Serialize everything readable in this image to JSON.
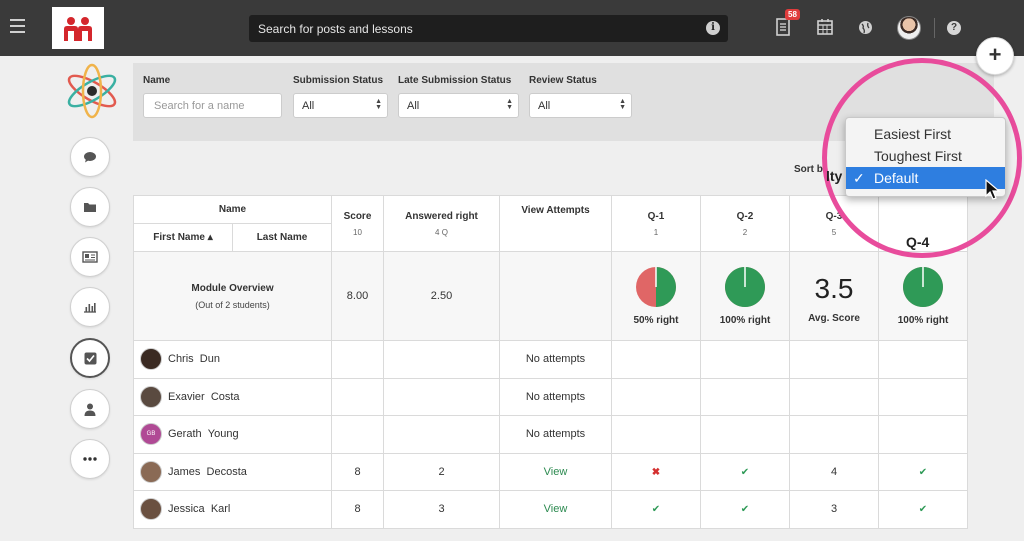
{
  "header": {
    "search_placeholder": "Search for posts and lessons",
    "notifications_count": "58"
  },
  "filters": {
    "name_label": "Name",
    "name_placeholder": "Search for a name",
    "submission_label": "Submission Status",
    "submission_value": "All",
    "late_label": "Late Submission Status",
    "late_value": "All",
    "review_label": "Review Status",
    "review_value": "All"
  },
  "sort": {
    "label": "Sort b",
    "peek_text": "lty",
    "options": [
      "Easiest First",
      "Toughest First",
      "Default"
    ],
    "selected_index": 2,
    "check": "✓"
  },
  "table": {
    "name_header": "Name",
    "first_name_header": "First Name ▴",
    "last_name_header": "Last Name",
    "score_header": "Score",
    "score_sub": "10",
    "answered_header": "Answered right",
    "answered_sub": "4 Q",
    "attempts_header": "View Attempts",
    "questions": [
      {
        "label": "Q-1",
        "sub": "1"
      },
      {
        "label": "Q-2",
        "sub": "2"
      },
      {
        "label": "Q-3",
        "sub": "5"
      },
      {
        "label": "Q-4",
        "sub": ""
      }
    ],
    "overview": {
      "title": "Module Overview",
      "subtitle": "(Out of 2 students)",
      "score": "8.00",
      "answered": "2.50",
      "q1_label": "50% right",
      "q1_fraction": 0.5,
      "q2_label": "100% right",
      "q2_fraction": 1.0,
      "q3_value": "3.5",
      "q3_label": "Avg. Score",
      "q4_label": "100% right",
      "q4_fraction": 1.0
    },
    "students": [
      {
        "first": "Chris",
        "last": "Dun",
        "score": "",
        "answered": "",
        "attempts": "No attempts",
        "q1": "",
        "q2": "",
        "q3": "",
        "q4": ""
      },
      {
        "first": "Exavier",
        "last": "Costa",
        "score": "",
        "answered": "",
        "attempts": "No attempts",
        "q1": "",
        "q2": "",
        "q3": "",
        "q4": ""
      },
      {
        "first": "Gerath",
        "last": "Young",
        "initials": "GB",
        "score": "",
        "answered": "",
        "attempts": "No attempts",
        "q1": "",
        "q2": "",
        "q3": "",
        "q4": ""
      },
      {
        "first": "James",
        "last": "Decosta",
        "score": "8",
        "answered": "2",
        "attempts": "View",
        "q1": "✖",
        "q2": "✔",
        "q3": "4",
        "q4": "✔"
      },
      {
        "first": "Jessica",
        "last": "Karl",
        "score": "8",
        "answered": "3",
        "attempts": "View",
        "q1": "✔",
        "q2": "✔",
        "q3": "3",
        "q4": "✔"
      }
    ]
  },
  "colors": {
    "correct": "#2f9a57",
    "wrong": "#e06666",
    "accent_ring": "#e84c9c",
    "selected": "#2e7ee0"
  },
  "icons": {
    "menu": "hamburger-icon",
    "info": "info-icon",
    "notifications": "document-icon",
    "calendar": "calendar-icon",
    "globe": "globe-icon",
    "help": "help-icon",
    "plus": "plus-icon"
  }
}
